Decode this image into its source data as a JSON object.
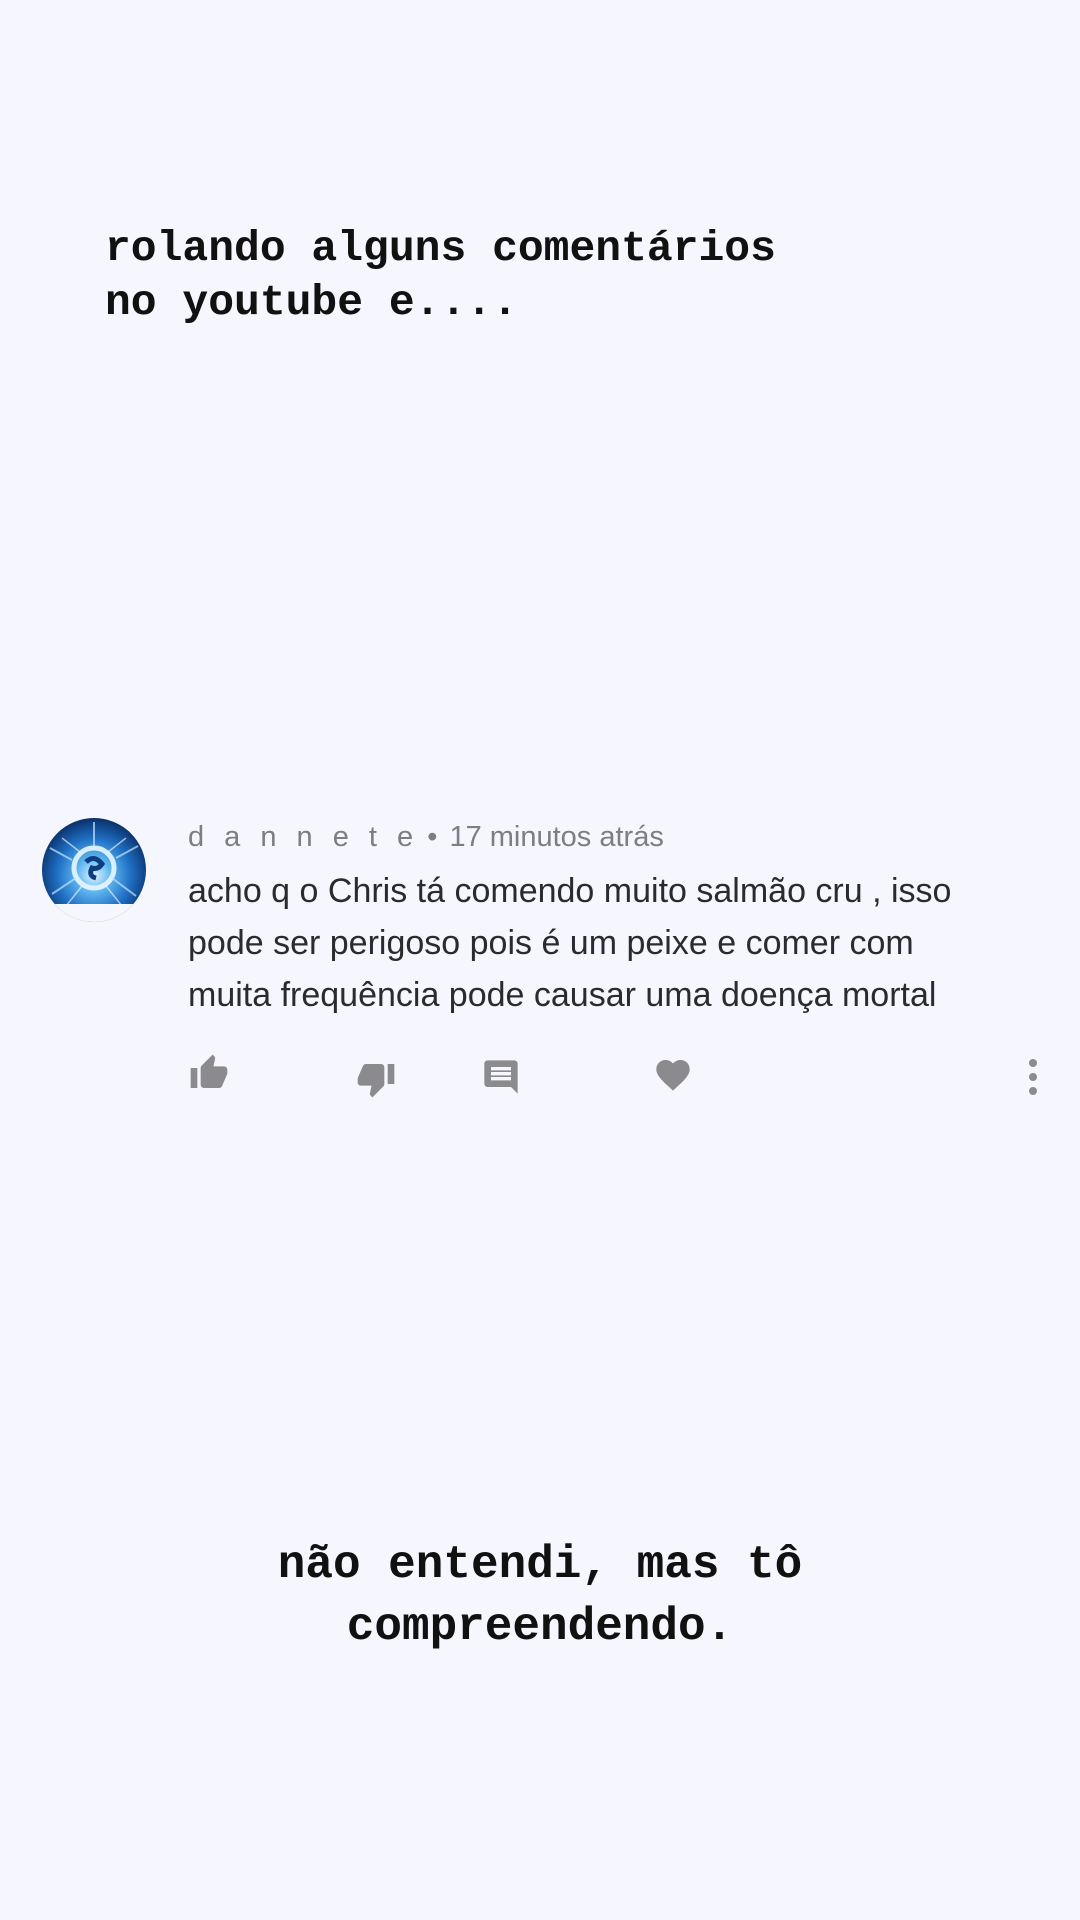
{
  "captions": {
    "top_line1": "rolando alguns comentários",
    "top_line2": "no youtube e....",
    "bottom_line1": "não entendi, mas tô",
    "bottom_line2": "compreendendo."
  },
  "comment": {
    "author": "d a n n e t e",
    "separator": "•",
    "time": "17 minutos atrás",
    "text_lines": [
      "acho q o Chris tá comendo muito salmão cru , isso",
      "pode ser perigoso pois é um peixe e comer com",
      "muita frequência pode causar uma doença mortal"
    ],
    "actions": {
      "like_icon": "thumbs-up-icon",
      "dislike_icon": "thumbs-down-icon",
      "reply_icon": "comment-icon",
      "heart_icon": "heart-icon",
      "more_icon": "more-vertical-icon"
    }
  },
  "colors": {
    "background": "#f5f6fe",
    "caption_text": "#111111",
    "meta_text": "#7d7d82",
    "comment_text": "#2b2b2e",
    "icon": "#8a8a8f"
  }
}
